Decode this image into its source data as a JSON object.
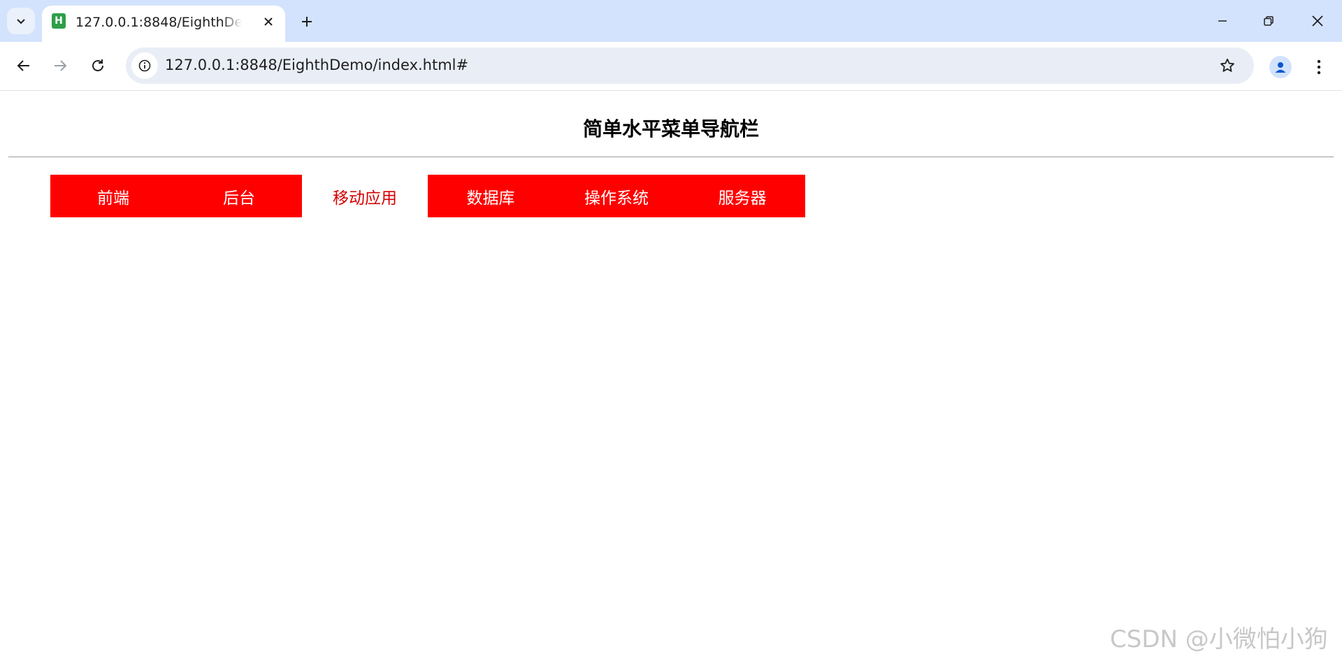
{
  "browser": {
    "tab": {
      "favicon_letter": "H",
      "title": "127.0.0.1:8848/EighthDemo/index.html#"
    },
    "address_bar": {
      "url": "127.0.0.1:8848/EighthDemo/index.html#"
    },
    "colors": {
      "tabbar_bg": "#d3e3fd",
      "omnibox_bg": "#e9eef6"
    }
  },
  "page": {
    "title": "简单水平菜单导航栏",
    "menu": {
      "items": [
        {
          "label": "前端",
          "state": "normal"
        },
        {
          "label": "后台",
          "state": "normal"
        },
        {
          "label": "移动应用",
          "state": "hover"
        },
        {
          "label": "数据库",
          "state": "normal"
        },
        {
          "label": "操作系统",
          "state": "normal"
        },
        {
          "label": "服务器",
          "state": "normal"
        }
      ],
      "colors": {
        "item_bg": "#ff0000",
        "item_text": "#ffffff",
        "hover_bg": "#ffffff",
        "hover_text": "#d40000"
      }
    }
  },
  "watermark": "CSDN @小微怕小狗"
}
